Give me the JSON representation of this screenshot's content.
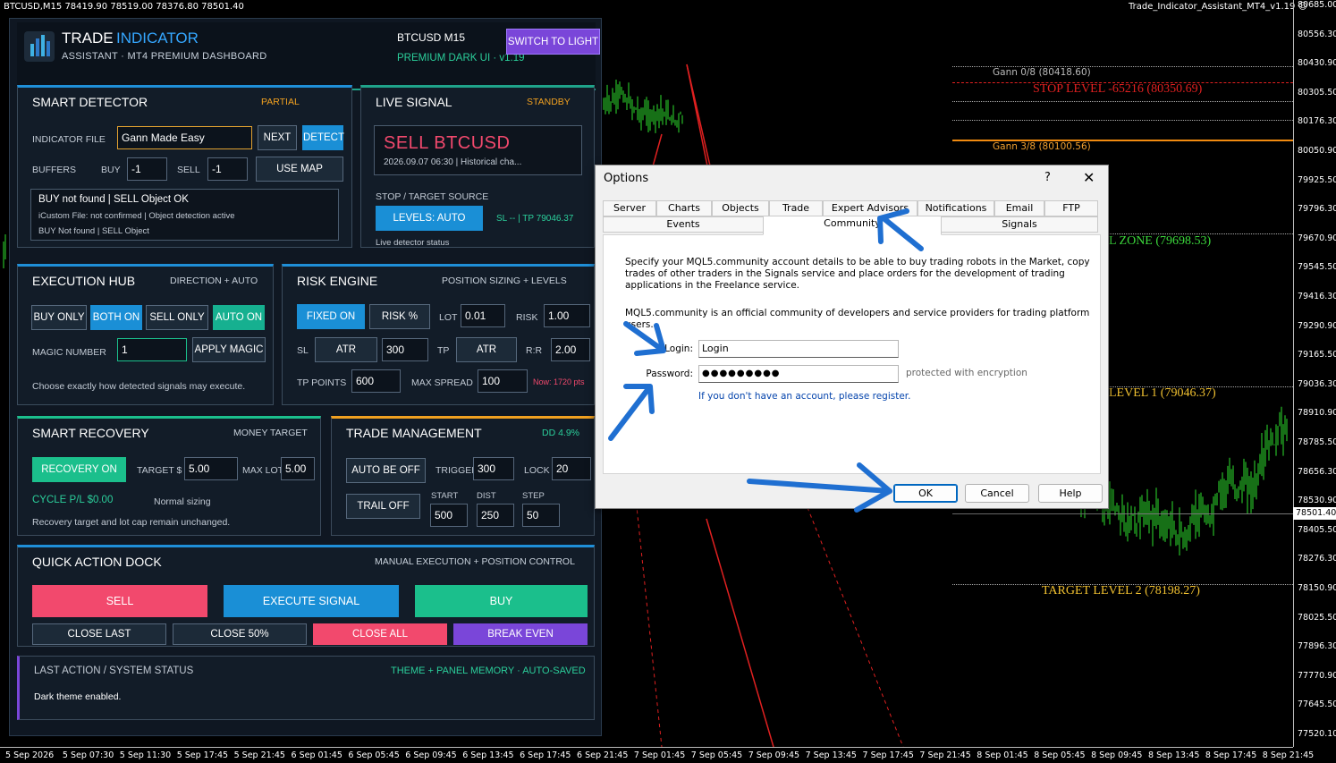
{
  "chart": {
    "title": "BTCUSD,M15  78419.90 78519.00 78376.80 78501.40",
    "indicator_name": "Trade_Indicator_Assistant_MT4_v1.19",
    "current_price": "78501.40",
    "price_labels": [
      "80685.00",
      "80556.30",
      "80430.90",
      "80305.50",
      "80176.30",
      "80050.90",
      "79925.50",
      "79796.30",
      "79670.90",
      "79545.50",
      "79416.30",
      "79290.90",
      "79165.50",
      "79036.30",
      "78910.90",
      "78785.50",
      "78656.30",
      "78530.90",
      "78405.50",
      "78276.30",
      "78150.90",
      "78025.50",
      "77896.30",
      "77770.90",
      "77645.50",
      "77520.10"
    ],
    "time_labels": [
      "5 Sep 2026",
      "5 Sep 07:30",
      "5 Sep 11:30",
      "5 Sep 17:45",
      "5 Sep 21:45",
      "6 Sep 01:45",
      "6 Sep 05:45",
      "6 Sep 09:45",
      "6 Sep 13:45",
      "6 Sep 17:45",
      "6 Sep 21:45",
      "7 Sep 01:45",
      "7 Sep 05:45",
      "7 Sep 09:45",
      "7 Sep 13:45",
      "7 Sep 17:45",
      "7 Sep 21:45",
      "8 Sep 01:45",
      "8 Sep 05:45",
      "8 Sep 09:45",
      "8 Sep 13:45",
      "8 Sep 17:45",
      "8 Sep 21:45"
    ],
    "levels": {
      "gann08": "Gann 0/8 (80418.60)",
      "stop": "STOP LEVEL -65216 (80350.69)",
      "gann38": "Gann 3/8 (80100.56)",
      "zone": "L ZONE (79698.53)",
      "target1": "LEVEL 1 (79046.37)",
      "target2": "TARGET LEVEL 2 (78198.27)"
    }
  },
  "dashboard": {
    "title_a": "TRADE",
    "title_b": "INDICATOR",
    "subtitle": "ASSISTANT · MT4 PREMIUM DASHBOARD",
    "symbol": "BTCUSD  M15",
    "version": "PREMIUM DARK UI · v1.19",
    "switch_label": "SWITCH TO LIGHT",
    "smart_detector": {
      "title": "SMART DETECTOR",
      "tag": "PARTIAL",
      "indicator_file_label": "INDICATOR FILE",
      "indicator_file": "Gann Made Easy",
      "next": "NEXT",
      "detect": "DETECT",
      "buffers_label": "BUFFERS",
      "buy_label": "BUY",
      "buy_value": "-1",
      "sell_label": "SELL",
      "sell_value": "-1",
      "use_map": "USE MAP",
      "status_main": "BUY not found | SELL Object OK",
      "status_sub1": "iCustom File: not confirmed | Object detection active",
      "status_sub2": "BUY Not found | SELL Object"
    },
    "live_signal": {
      "title": "LIVE SIGNAL",
      "tag": "STANDBY",
      "signal": "SELL  BTCUSD",
      "detail": "2026.09.07 06:30 | Historical cha...",
      "source_label": "STOP / TARGET SOURCE",
      "levels_btn": "LEVELS: AUTO",
      "sl_tp": "SL -- | TP 79046.37",
      "status": "Live detector status"
    },
    "execution_hub": {
      "title": "EXECUTION HUB",
      "tag": "DIRECTION + AUTO",
      "buy_only": "BUY ONLY",
      "both_on": "BOTH ON",
      "sell_only": "SELL ONLY",
      "auto_on": "AUTO ON",
      "magic_label": "MAGIC NUMBER",
      "magic_value": "1",
      "apply_magic": "APPLY MAGIC",
      "note": "Choose exactly how detected signals may execute."
    },
    "risk_engine": {
      "title": "RISK ENGINE",
      "tag": "POSITION SIZING + LEVELS",
      "fixed_on": "FIXED ON",
      "risk_pct": "RISK %",
      "lot_label": "LOT",
      "lot_value": "0.01",
      "risk_label": "RISK",
      "risk_value": "1.00",
      "sl_label": "SL",
      "sl_mode": "ATR",
      "sl_value": "300",
      "tp_label": "TP",
      "tp_mode": "ATR",
      "rr_label": "R:R",
      "rr_value": "2.00",
      "tp_points_label": "TP POINTS",
      "tp_points_value": "600",
      "max_spread_label": "MAX SPREAD",
      "max_spread_value": "100",
      "spread_now": "Now: 1720 pts"
    },
    "smart_recovery": {
      "title": "SMART RECOVERY",
      "tag": "MONEY TARGET",
      "recovery_on": "RECOVERY ON",
      "target_label": "TARGET $",
      "target_value": "5.00",
      "max_lot_label": "MAX LOT",
      "max_lot_value": "5.00",
      "cycle": "CYCLE P/L $0.00",
      "sizing": "Normal sizing",
      "note": "Recovery target and lot cap remain unchanged."
    },
    "trade_management": {
      "title": "TRADE MANAGEMENT",
      "tag": "DD 4.9%",
      "auto_be": "AUTO BE OFF",
      "trigger_label": "TRIGGER",
      "trigger_value": "300",
      "lock_label": "LOCK",
      "lock_value": "20",
      "trail": "TRAIL OFF",
      "start_label": "START",
      "start_value": "500",
      "dist_label": "DIST",
      "dist_value": "250",
      "step_label": "STEP",
      "step_value": "50"
    },
    "quick_action": {
      "title": "QUICK ACTION DOCK",
      "tag": "MANUAL EXECUTION + POSITION CONTROL",
      "sell": "SELL",
      "execute": "EXECUTE SIGNAL",
      "buy": "BUY",
      "close_last": "CLOSE LAST",
      "close_50": "CLOSE 50%",
      "close_all": "CLOSE ALL",
      "break_even": "BREAK EVEN"
    },
    "status": {
      "title": "LAST ACTION / SYSTEM STATUS",
      "tag": "THEME + PANEL MEMORY · AUTO-SAVED",
      "message": "Dark theme enabled."
    }
  },
  "dialog": {
    "title": "Options",
    "help_glyph": "?",
    "close_glyph": "✕",
    "tabs_row1": [
      "Server",
      "Charts",
      "Objects",
      "Trade",
      "Expert Advisors",
      "Notifications",
      "Email",
      "FTP"
    ],
    "tabs_row2": [
      "Events",
      "Community",
      "Signals"
    ],
    "active_tab": "Community",
    "text1": "Specify your MQL5.community account details to be able to buy trading robots in the Market, copy trades of other traders in the Signals service and place orders for the development of trading applications in the Freelance service.",
    "text2": "MQL5.community is an official community of developers and service providers for trading platform users.",
    "login_label": "Login:",
    "login_value": "Login",
    "password_label": "Password:",
    "password_value": "●●●●●●●●●",
    "encryption_note": "protected with encryption",
    "register_link": "If you don't have an account, please register.",
    "ok": "OK",
    "cancel": "Cancel",
    "help": "Help"
  },
  "colors": {
    "accent_blue": "#1a8fd6",
    "accent_green": "#1bbf8c",
    "accent_red": "#f2496d",
    "accent_purple": "#7a46d9",
    "annotation_arrow": "#1f6fd1"
  }
}
